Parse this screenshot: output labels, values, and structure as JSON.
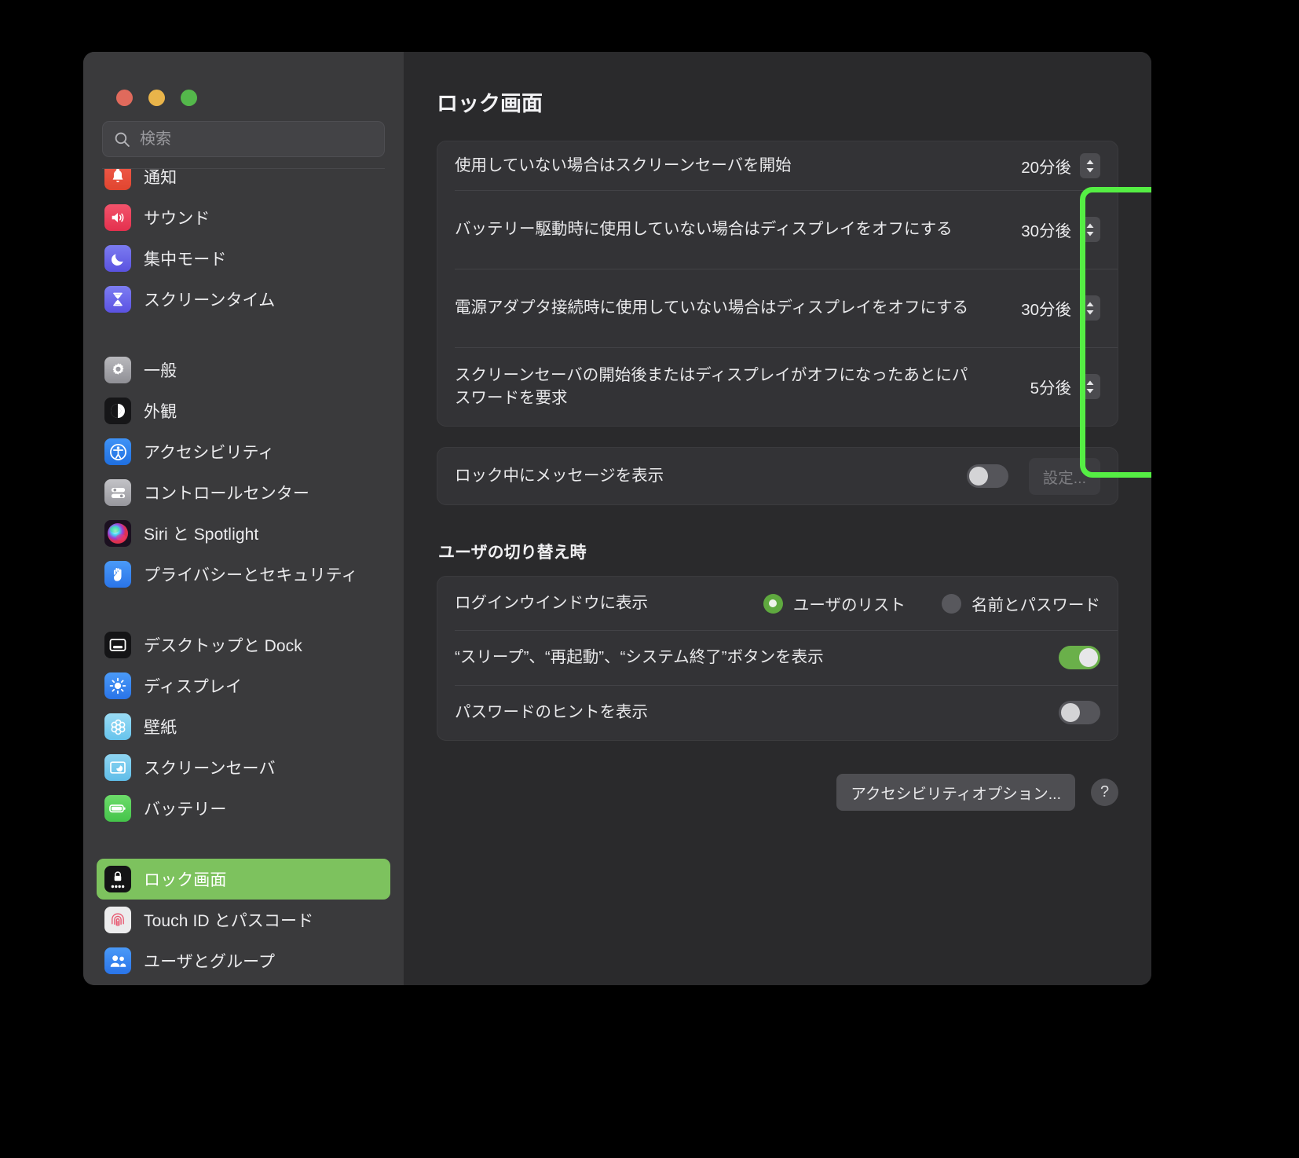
{
  "window": {
    "traffic_lights": [
      "close",
      "minimize",
      "zoom"
    ],
    "colors": {
      "close": "#e06a5c",
      "minimize": "#e9b44a",
      "zoom": "#54b84b",
      "sidebar_selected": "#7dc25e",
      "annotation": "#55ee44",
      "toggle_on": "#6ab04a",
      "radio_on": "#5fa93f"
    }
  },
  "search": {
    "placeholder": "検索",
    "value": "",
    "icon": "search-icon"
  },
  "sidebar": {
    "groups": [
      {
        "items": [
          {
            "label": "通知",
            "icon": "notifications-icon",
            "selected": false
          },
          {
            "label": "サウンド",
            "icon": "sound-icon",
            "selected": false
          },
          {
            "label": "集中モード",
            "icon": "focus-icon",
            "selected": false
          },
          {
            "label": "スクリーンタイム",
            "icon": "screen-time-icon",
            "selected": false
          }
        ]
      },
      {
        "items": [
          {
            "label": "一般",
            "icon": "general-gear-icon",
            "selected": false
          },
          {
            "label": "外観",
            "icon": "appearance-icon",
            "selected": false
          },
          {
            "label": "アクセシビリティ",
            "icon": "accessibility-icon",
            "selected": false
          },
          {
            "label": "コントロールセンター",
            "icon": "control-center-icon",
            "selected": false
          },
          {
            "label": "Siri と Spotlight",
            "icon": "siri-icon",
            "selected": false
          },
          {
            "label": "プライバシーとセキュリティ",
            "icon": "privacy-hand-icon",
            "selected": false
          }
        ]
      },
      {
        "items": [
          {
            "label": "デスクトップと Dock",
            "icon": "desktop-dock-icon",
            "selected": false
          },
          {
            "label": "ディスプレイ",
            "icon": "display-icon",
            "selected": false
          },
          {
            "label": "壁紙",
            "icon": "wallpaper-icon",
            "selected": false
          },
          {
            "label": "スクリーンセーバ",
            "icon": "screen-saver-icon",
            "selected": false
          },
          {
            "label": "バッテリー",
            "icon": "battery-icon",
            "selected": false
          }
        ]
      },
      {
        "items": [
          {
            "label": "ロック画面",
            "icon": "lock-screen-icon",
            "selected": true
          },
          {
            "label": "Touch ID とパスコード",
            "icon": "touch-id-icon",
            "selected": false
          },
          {
            "label": "ユーザとグループ",
            "icon": "users-groups-icon",
            "selected": false
          }
        ]
      }
    ]
  },
  "main": {
    "title": "ロック画面",
    "timing_rows": [
      {
        "label": "使用していない場合はスクリーンセーバを開始",
        "value": "20分後"
      },
      {
        "label": "バッテリー駆動時に使用していない場合はディスプレイをオフにする",
        "value": "30分後"
      },
      {
        "label": "電源アダプタ接続時に使用していない場合はディスプレイをオフにする",
        "value": "30分後"
      },
      {
        "label": "スクリーンセーバの開始後またはディスプレイがオフになったあとにパスワードを要求",
        "value": "5分後"
      }
    ],
    "message_row": {
      "label": "ロック中にメッセージを表示",
      "toggle_state": "off",
      "button_label": "設定...",
      "button_disabled": true
    },
    "section_heading": "ユーザの切り替え時",
    "login_window_row": {
      "label": "ログインウインドウに表示",
      "options": [
        {
          "label": "ユーザのリスト",
          "selected": true
        },
        {
          "label": "名前とパスワード",
          "selected": false
        }
      ]
    },
    "power_buttons_row": {
      "label": "“スリープ”、“再起動”、“システム終了”ボタンを表示",
      "toggle_state": "on"
    },
    "password_hint_row": {
      "label": "パスワードのヒントを表示",
      "toggle_state": "off"
    },
    "accessibility_button": "アクセシビリティオプション...",
    "help_button": "?"
  }
}
